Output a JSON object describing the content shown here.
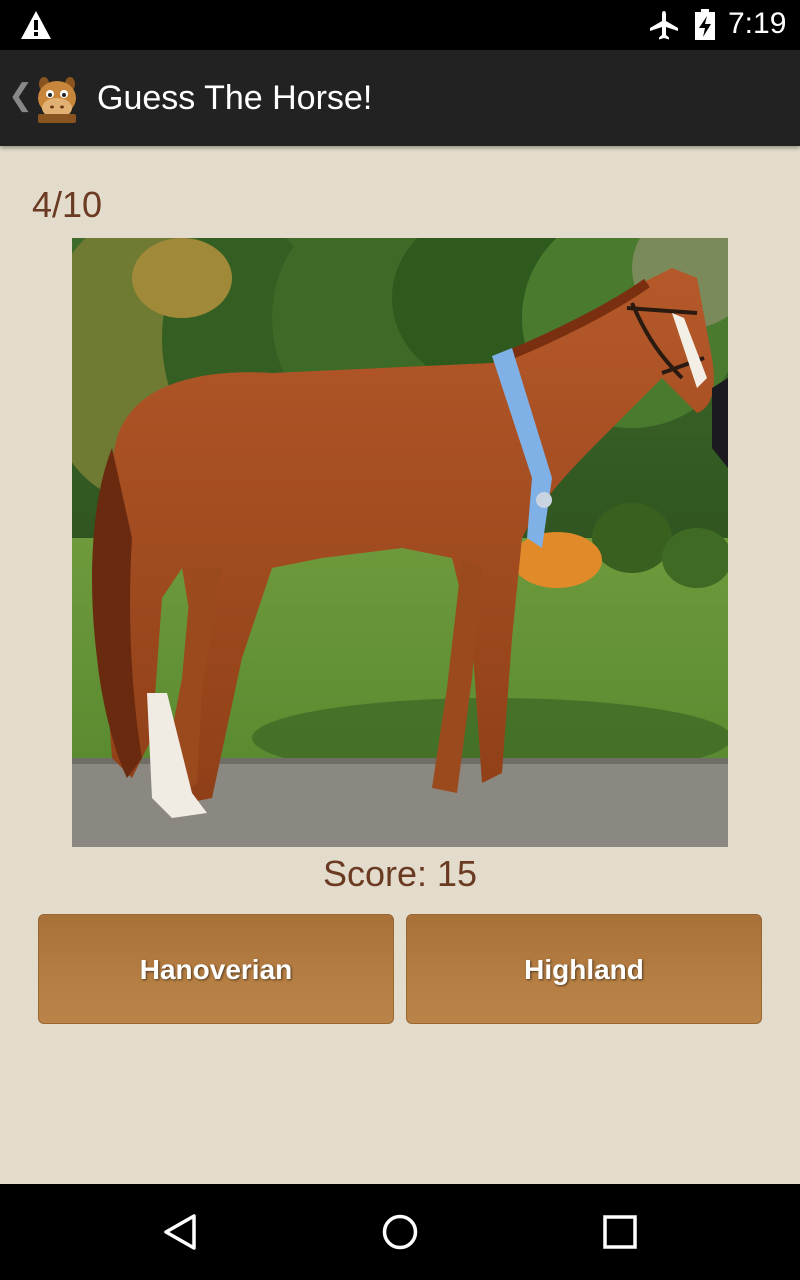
{
  "status_bar": {
    "time": "7:19",
    "icons": [
      "warning-icon",
      "airplane-mode-icon",
      "battery-charging-icon"
    ]
  },
  "action_bar": {
    "back_glyph": "❮",
    "title": "Guess The Horse!",
    "logo_icon": "horse-face-icon"
  },
  "quiz": {
    "progress": "4/10",
    "score_label": "Score: 15",
    "answers": [
      "Hanoverian",
      "Highland"
    ]
  },
  "nav_bar": {
    "icons": [
      "back-icon",
      "home-icon",
      "recents-icon"
    ]
  },
  "colors": {
    "background": "#e3dccc",
    "accent_text": "#6b3a22",
    "button": "#b07a40",
    "action_bar": "#222222"
  }
}
